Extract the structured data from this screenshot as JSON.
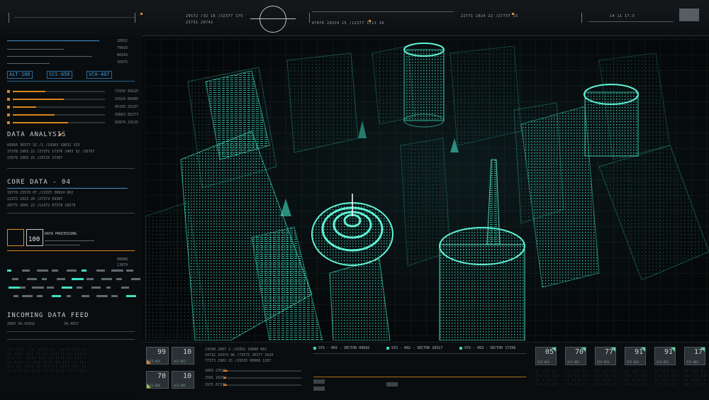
{
  "top": {
    "readouts": [
      "29572 /32 16 /32377 175",
      "23731 26742",
      "07076 20324 15 /12377 1711 10",
      "22771 2024 22 /27737 15",
      "14 11 17.3"
    ],
    "accent": "#e58a1e"
  },
  "left": {
    "stats": [
      "28952",
      "79016",
      "80164",
      "16975"
    ],
    "chips": [
      "ALT-100",
      "SCS-050",
      "VCH-407"
    ],
    "bars": [
      {
        "code": "73150 84225",
        "level": 0.35
      },
      {
        "code": "15524 86905",
        "level": 0.55
      },
      {
        "code": "05103 25197",
        "level": 0.25
      },
      {
        "code": "03663 85277",
        "level": 0.45
      },
      {
        "code": "03974 29125",
        "level": 0.6
      }
    ],
    "data_analysis": {
      "title": "DATA ANALYSIS",
      "lines": [
        "03956 36577 32 /1 /29303 19032 323",
        "37378 2903 22 /27371 17376 2403 32 /26767",
        "23579 2903 25 /23725 27307"
      ]
    },
    "core_data": {
      "title": "CORE DATA - 04",
      "lines": [
        "18778 23578 07 /13325 30624 602",
        "22373 2023 20 /27374 09307",
        "28775 3001 22 /11472 07378 18570"
      ]
    },
    "processing": {
      "label": "DATA PROCESSING",
      "value": "100"
    },
    "codes": [
      "08908",
      "13879"
    ],
    "feed_title": "INCOMING DATA FEED",
    "feed_lines": [
      "2903 34.42932",
      "34.4557"
    ]
  },
  "bottom": {
    "tiles": [
      {
        "value": "99",
        "code": "SCS-054"
      },
      {
        "value": "10",
        "code": "SCS-012"
      },
      {
        "value": "70",
        "code": "SCS-038"
      },
      {
        "value": "10",
        "code": "SCS-044"
      }
    ],
    "readouts": [
      "23598 2007 2 /29352 19000 061",
      "10732 29374 06 /73575 20377 1020",
      "77373 2902 15 /29535 08960 1207",
      "1803 23520",
      "1501 18250",
      "2975 07370"
    ],
    "sectors": [
      {
        "label": "SYS - 001 - SECTOR 09042"
      },
      {
        "label": "SYS - 002 - SECTOR 28317"
      },
      {
        "label": "SYS - 003 - SECTOR 17256"
      }
    ],
    "gauges": [
      {
        "value": "05",
        "code": "SCS-054"
      },
      {
        "value": "70",
        "code": "SCS-062"
      },
      {
        "value": "77",
        "code": "SCS-050"
      },
      {
        "value": "91",
        "code": "SCS-033"
      },
      {
        "value": "91",
        "code": "SCS-051"
      },
      {
        "value": "17",
        "code": "SCS-065"
      }
    ]
  },
  "colors": {
    "hologram": "#3fe0c2",
    "accent": "#e58a1e",
    "chip": "#3aa0e8"
  }
}
